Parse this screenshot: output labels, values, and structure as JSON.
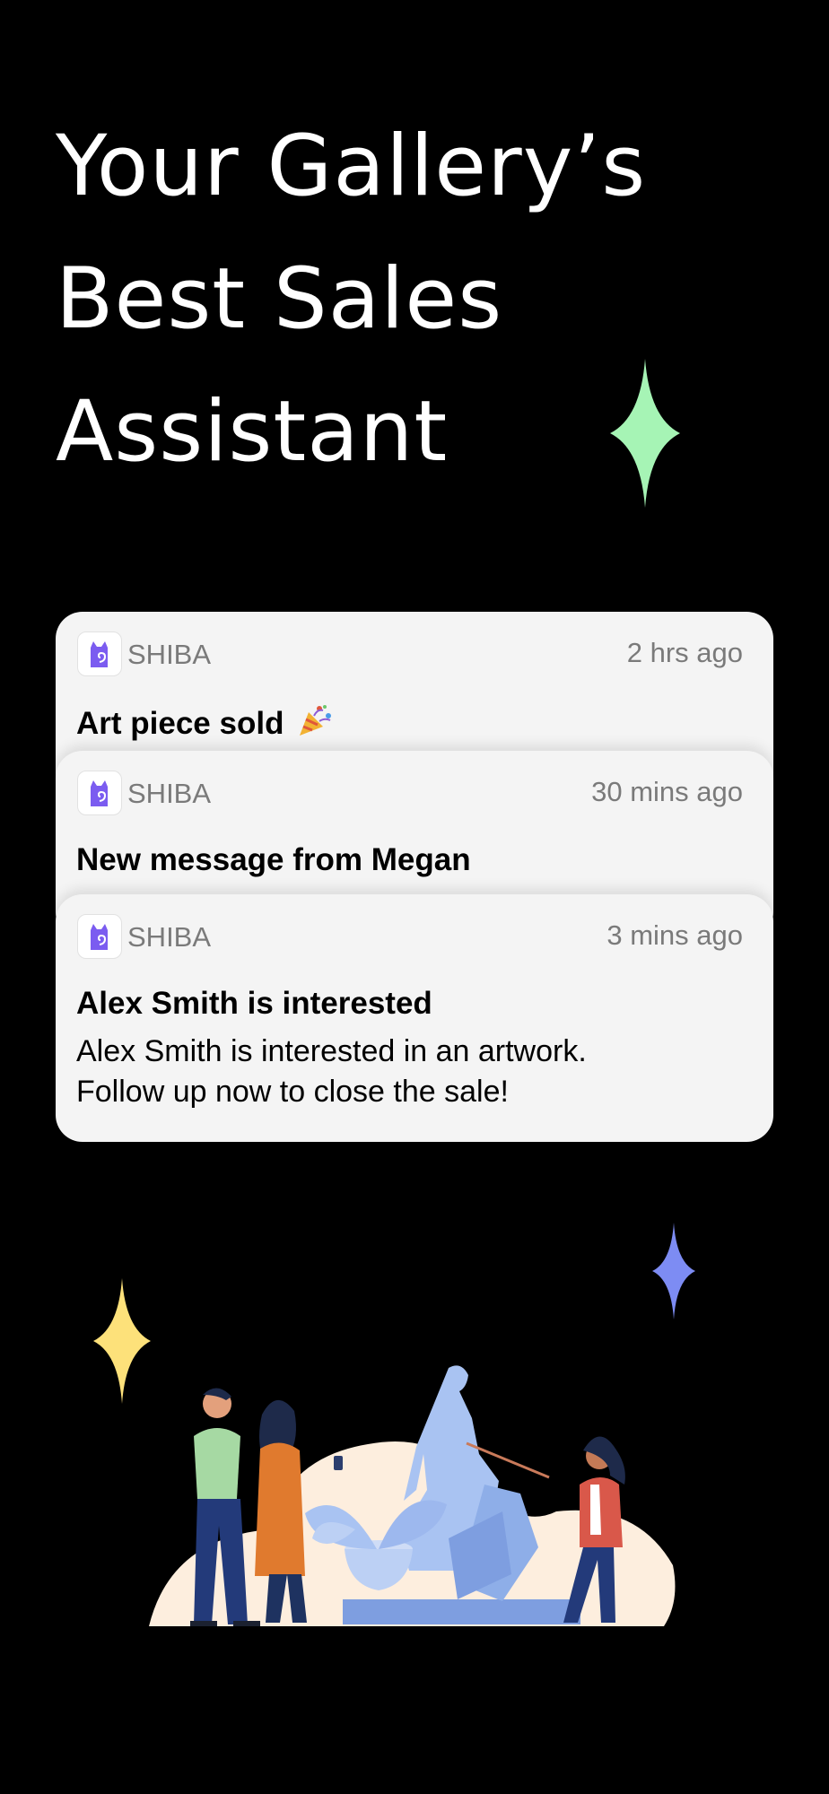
{
  "headline": {
    "line1": "Your Gallery’s",
    "line2": "Best Sales",
    "line3": "Assistant"
  },
  "notifications": [
    {
      "app": "SHIBA",
      "time": "2 hrs ago",
      "title": "Art piece sold",
      "body": ""
    },
    {
      "app": "SHIBA",
      "time": "30 mins ago",
      "title": "New message from Megan",
      "body": ""
    },
    {
      "app": "SHIBA",
      "time": "3 mins ago",
      "title": "Alex Smith is interested",
      "body_line1": "Alex Smith is interested in an artwork.",
      "body_line2": "Follow up now to close the sale!"
    }
  ],
  "icons": {
    "app": "shiba-cat-icon",
    "celebration": "party-popper-icon",
    "decor": [
      "green-sparkle-icon",
      "yellow-sparkle-icon",
      "blue-sparkle-icon"
    ]
  },
  "colors": {
    "background": "#000000",
    "card": "#f4f4f4",
    "accent_purple": "#7b5cf0",
    "sparkle_green": "#a6f4b5",
    "sparkle_yellow": "#fde17a",
    "sparkle_blue": "#7d8cf3"
  }
}
